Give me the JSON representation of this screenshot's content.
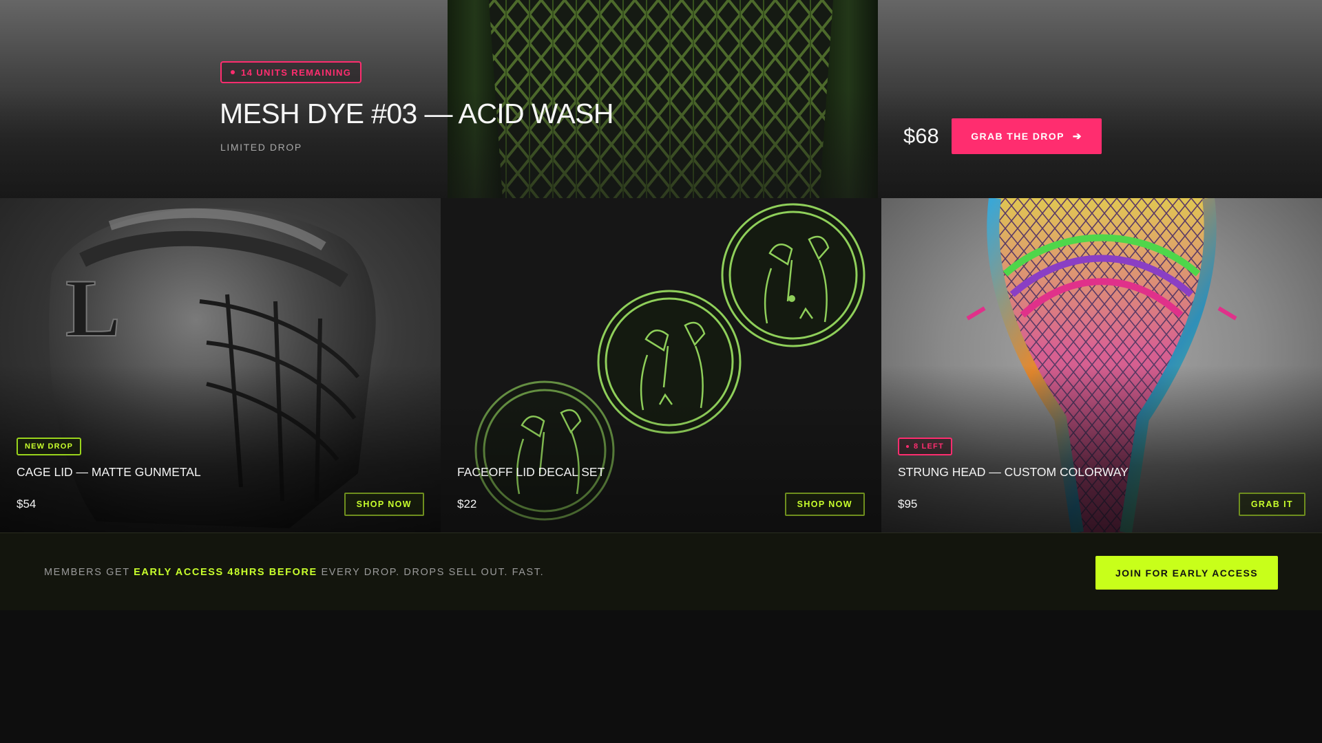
{
  "hero": {
    "badge": "14 UNITS REMAINING",
    "title": "MESH DYE #03 — ACID WASH",
    "subtitle": "LIMITED DROP",
    "price": "$68",
    "cta_label": "GRAB THE DROP",
    "cta_icon": "arrow-right-icon"
  },
  "products": [
    {
      "badge": "NEW DROP",
      "badge_style": "green",
      "title": "CAGE LID — MATTE GUNMETAL",
      "price": "$54",
      "cta_label": "SHOP NOW"
    },
    {
      "title": "FACEOFF LID DECAL SET",
      "price": "$22",
      "cta_label": "SHOP NOW"
    },
    {
      "badge": "8 LEFT",
      "badge_style": "pink",
      "title": "STRUNG HEAD — CUSTOM COLORWAY",
      "price": "$95",
      "cta_label": "GRAB IT"
    }
  ],
  "members": {
    "text_before": "MEMBERS GET ",
    "text_highlight": "EARLY ACCESS 48HRS BEFORE",
    "text_after": " EVERY DROP. DROPS SELL OUT. FAST.",
    "cta_label": "JOIN FOR EARLY ACCESS"
  },
  "colors": {
    "accent_pink": "#ff2d6f",
    "accent_lime": "#c8ff1a",
    "background": "#0e0e0e"
  }
}
